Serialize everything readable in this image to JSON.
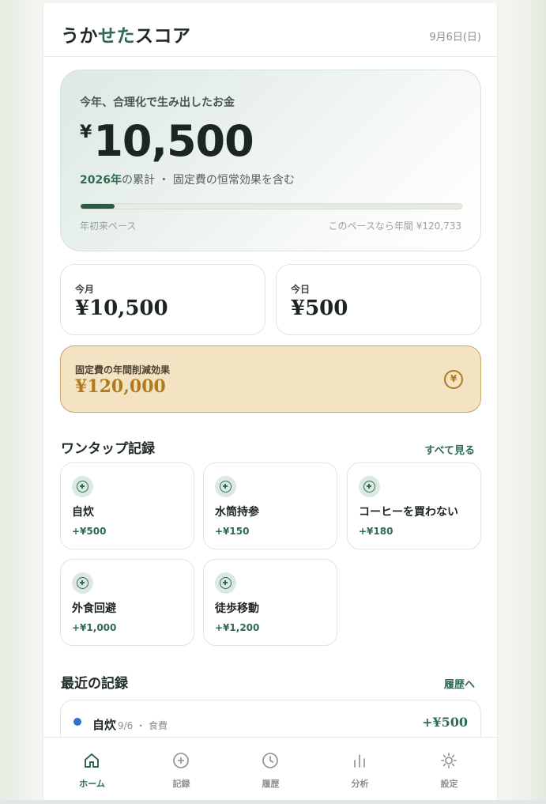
{
  "header": {
    "title_part1": "うか",
    "title_accent": "せた",
    "title_part2": "スコア",
    "date": "9月6日(日)"
  },
  "hero": {
    "label": "今年、合理化で生み出したお金",
    "currency": "¥",
    "amount": "10,500",
    "year": "2026年",
    "sub_text": "の累計 ・ 固定費の恒常効果を含む",
    "progress_fraction": 0.09,
    "progress_left_label": "年初来ペース",
    "progress_right_label": "このペースなら年間 ¥120,733"
  },
  "stats": {
    "month_label": "今月",
    "month_value": "¥10,500",
    "today_label": "今日",
    "today_value": "¥500"
  },
  "fixed_cost": {
    "label": "固定費の年間削減効果",
    "value": "¥120,000",
    "icon": "coin-icon"
  },
  "quick": {
    "title": "ワンタップ記録",
    "see_all": "すべて見る",
    "tiles": [
      {
        "name": "自炊",
        "amount": "+¥500"
      },
      {
        "name": "水筒持参",
        "amount": "+¥150"
      },
      {
        "name": "コーヒーを買わない",
        "amount": "+¥180"
      },
      {
        "name": "外食回避",
        "amount": "+¥1,000"
      },
      {
        "name": "徒歩移動",
        "amount": "+¥1,200"
      }
    ]
  },
  "recent": {
    "title": "最近の記録",
    "history_link": "履歴へ",
    "items": [
      {
        "name": "自炊",
        "meta": "9/6 ・ 食費",
        "amount": "+¥500",
        "dot_color": "#2f6fd6"
      }
    ]
  },
  "nav": {
    "items": [
      {
        "label": "ホーム",
        "icon": "home-icon",
        "active": true
      },
      {
        "label": "記録",
        "icon": "plus-circle-icon",
        "active": false
      },
      {
        "label": "履歴",
        "icon": "clock-icon",
        "active": false
      },
      {
        "label": "分析",
        "icon": "bar-chart-icon",
        "active": false
      },
      {
        "label": "設定",
        "icon": "sun-icon",
        "active": false
      }
    ]
  },
  "colors": {
    "accent": "#2e6b52",
    "gold": "#b07b1f",
    "fixed_bg": "#f3e3c3"
  }
}
